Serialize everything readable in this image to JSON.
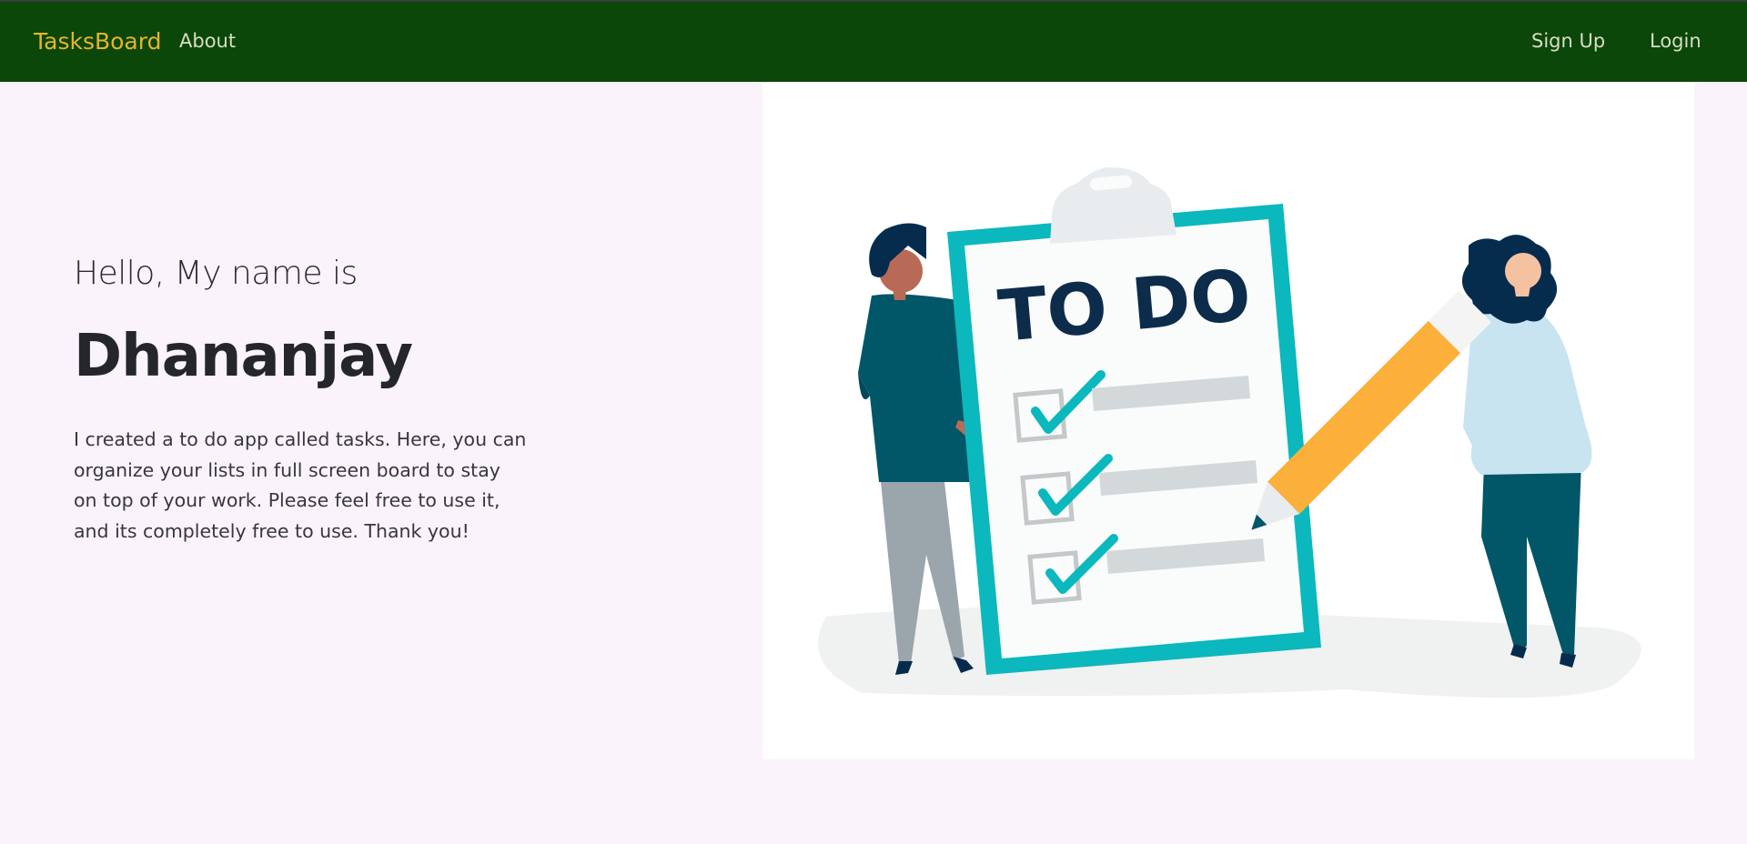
{
  "navbar": {
    "brand": "TasksBoard",
    "links": {
      "about": "About",
      "signup": "Sign Up",
      "login": "Login"
    },
    "colors": {
      "background": "#0b4708",
      "brand": "#e6b32e",
      "link": "#d9dcc6"
    }
  },
  "hero": {
    "greeting": "Hello, My name is",
    "name": "Dhananjay",
    "description": "I created a to do app called tasks. Here, you can organize your lists in full screen board to stay on top of your work. Please feel free to use it, and its completely free to use. Thank you!",
    "illustration": {
      "clipboard_title": "TO DO",
      "checked_items": 3,
      "colors": {
        "clipboard": "#0bb8bd",
        "title": "#0d2c4c",
        "pencil": "#fbb03b"
      }
    }
  },
  "page": {
    "background": "#faf3fc"
  }
}
